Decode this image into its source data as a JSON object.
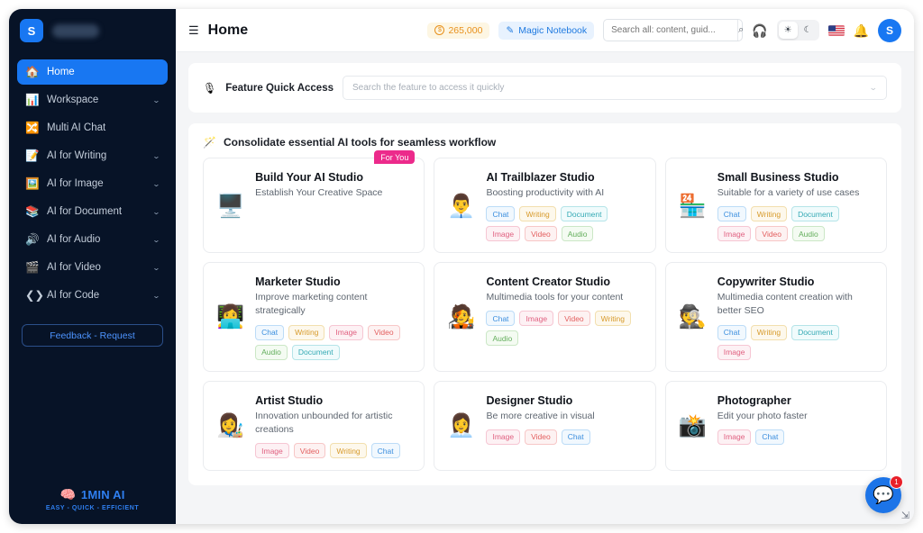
{
  "sidebar": {
    "logo_letter": "S",
    "workspace_name_masked": "",
    "items": [
      {
        "label": "Home",
        "icon": "🏠",
        "chevron": false,
        "active": true
      },
      {
        "label": "Workspace",
        "icon": "📊",
        "chevron": true,
        "active": false
      },
      {
        "label": "Multi AI Chat",
        "icon": "🔀",
        "chevron": false,
        "active": false
      },
      {
        "label": "AI for Writing",
        "icon": "📝",
        "chevron": true,
        "active": false
      },
      {
        "label": "AI for Image",
        "icon": "🖼️",
        "chevron": true,
        "active": false
      },
      {
        "label": "AI for Document",
        "icon": "📚",
        "chevron": true,
        "active": false
      },
      {
        "label": "AI for Audio",
        "icon": "🔊",
        "chevron": true,
        "active": false
      },
      {
        "label": "AI for Video",
        "icon": "🎬",
        "chevron": true,
        "active": false
      },
      {
        "label": "AI for Code",
        "icon": "❮❯",
        "chevron": true,
        "active": false
      }
    ],
    "feedback_label": "Feedback - Request",
    "brand_name": "1MIN AI",
    "brand_icon": "🧠",
    "brand_tagline": "EASY - QUICK - EFFICIENT"
  },
  "topbar": {
    "menu_icon": "☰",
    "title": "Home",
    "credits_value": "265,000",
    "credits_icon": "$",
    "notebook_label": "Magic Notebook",
    "notebook_icon": "✎",
    "search_placeholder": "Search all: content, guid...",
    "search_value": "",
    "search_icon": "⌕",
    "headphones_icon": "🎧",
    "light_icon": "☀",
    "dark_icon": "☾",
    "theme_active": "light",
    "flag_label": "US",
    "bell_icon": "🔔",
    "avatar_letter": "S"
  },
  "quick_access": {
    "icon": "🎙",
    "label": "Feature Quick Access",
    "placeholder": "Search the feature to access it quickly",
    "chevron": "⌄"
  },
  "section": {
    "icon": "🪄",
    "title": "Consolidate essential AI tools for seamless workflow"
  },
  "cards": [
    {
      "title": "Build Your AI Studio",
      "desc": "Establish Your Creative Space",
      "icon": "🖥️",
      "badge": "For You",
      "tags": []
    },
    {
      "title": "AI Trailblazer Studio",
      "desc": "Boosting productivity with AI",
      "icon": "👨‍💼",
      "badge": "",
      "tags": [
        "Chat",
        "Writing",
        "Document",
        "Image",
        "Video",
        "Audio"
      ]
    },
    {
      "title": "Small Business Studio",
      "desc": "Suitable for a variety of use cases",
      "icon": "🏪",
      "badge": "",
      "tags": [
        "Chat",
        "Writing",
        "Document",
        "Image",
        "Video",
        "Audio"
      ]
    },
    {
      "title": "Marketer Studio",
      "desc": "Improve marketing content strategically",
      "icon": "👩‍💻",
      "badge": "",
      "tags": [
        "Chat",
        "Writing",
        "Image",
        "Video",
        "Audio",
        "Document"
      ]
    },
    {
      "title": "Content Creator Studio",
      "desc": "Multimedia tools for your content",
      "icon": "🧑‍🎤",
      "badge": "",
      "tags": [
        "Chat",
        "Image",
        "Video",
        "Writing",
        "Audio"
      ]
    },
    {
      "title": "Copywriter Studio",
      "desc": "Multimedia content creation with better SEO",
      "icon": "🕵️",
      "badge": "",
      "tags": [
        "Chat",
        "Writing",
        "Document",
        "Image"
      ]
    },
    {
      "title": "Artist Studio",
      "desc": "Innovation unbounded for artistic creations",
      "icon": "👩‍🎨",
      "badge": "",
      "tags": [
        "Image",
        "Video",
        "Writing",
        "Chat"
      ]
    },
    {
      "title": "Designer Studio",
      "desc": "Be more creative in visual",
      "icon": "👩‍💼",
      "badge": "",
      "tags": [
        "Image",
        "Video",
        "Chat"
      ]
    },
    {
      "title": "Photographer",
      "desc": "Edit your photo faster",
      "icon": "📸",
      "badge": "",
      "tags": [
        "Image",
        "Chat"
      ]
    }
  ],
  "chat_widget": {
    "icon": "💬",
    "badge_count": "1"
  },
  "resize_icon": "⇲",
  "colors": {
    "accent_blue": "#1877f2",
    "sidebar_bg": "#071327",
    "badge_pink": "#ec2a8b",
    "credits_orange": "#e8901b",
    "notification_red": "#e8202a"
  }
}
